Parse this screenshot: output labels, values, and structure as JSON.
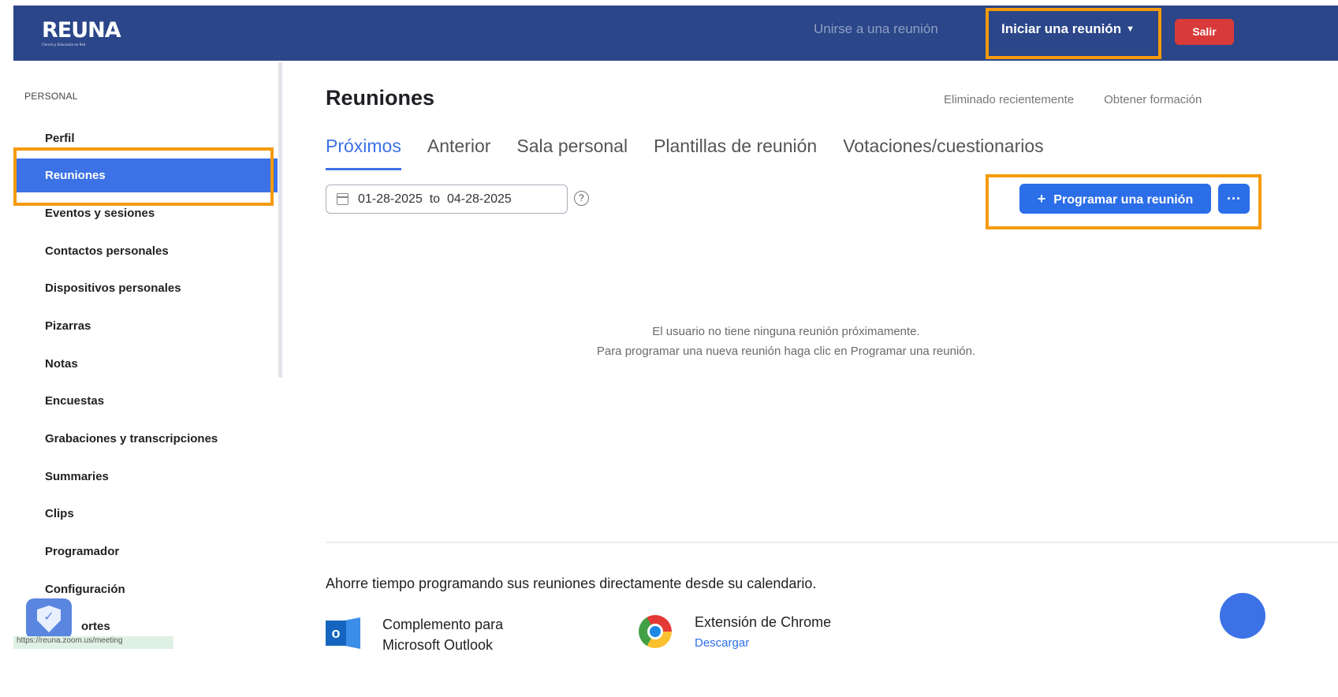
{
  "header": {
    "logo_text": "REUNA",
    "logo_tagline": "Ciencia y Educación en Red",
    "join_label": "Unirse a una reunión",
    "start_label": "Iniciar una reunión",
    "logout_label": "Salir"
  },
  "sidebar": {
    "section_title": "PERSONAL",
    "items": [
      {
        "label": "Perfil"
      },
      {
        "label": "Reuniones"
      },
      {
        "label": "Eventos y sesiones"
      },
      {
        "label": "Contactos personales"
      },
      {
        "label": "Dispositivos personales"
      },
      {
        "label": "Pizarras"
      },
      {
        "label": "Notas"
      },
      {
        "label": "Encuestas"
      },
      {
        "label": "Grabaciones y transcripciones"
      },
      {
        "label": "Summaries"
      },
      {
        "label": "Clips"
      },
      {
        "label": "Programador"
      },
      {
        "label": "Configuración"
      },
      {
        "label": "ortes"
      }
    ],
    "active_index": 1
  },
  "main": {
    "title": "Reuniones",
    "links": {
      "recently_deleted": "Eliminado recientemente",
      "training": "Obtener formación"
    },
    "tabs": [
      {
        "label": "Próximos"
      },
      {
        "label": "Anterior"
      },
      {
        "label": "Sala personal"
      },
      {
        "label": "Plantillas de reunión"
      },
      {
        "label": "Votaciones/cuestionarios"
      }
    ],
    "active_tab": 0,
    "date_range": "01-28-2025  to  04-28-2025",
    "schedule_button": "Programar una reunión",
    "more_button": "···",
    "empty_line1": "El usuario no tiene ninguna reunión próximamente.",
    "empty_line2": "Para programar una nueva reunión haga clic en Programar una reunión.",
    "promo_text": "Ahorre tiempo programando sus reuniones directamente desde su calendario.",
    "outlook_label": "Complemento para\nMicrosoft Outlook",
    "chrome_label": "Extensión de Chrome",
    "chrome_link": "Descargar",
    "status_url": "https://reuna.zoom.us/meeting"
  },
  "colors": {
    "header_bg": "#2b4689",
    "accent": "#3c72e6",
    "logout": "#d83a3a",
    "highlight": "#f59a0b"
  }
}
